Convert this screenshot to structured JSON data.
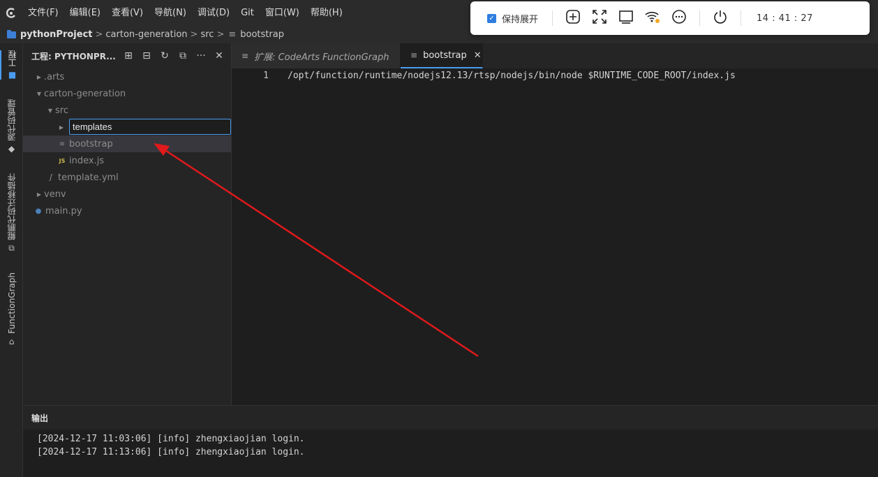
{
  "menubar": {
    "items": [
      {
        "label": "文件(F)"
      },
      {
        "label": "编辑(E)"
      },
      {
        "label": "查看(V)"
      },
      {
        "label": "导航(N)"
      },
      {
        "label": "调试(D)"
      },
      {
        "label": "Git"
      },
      {
        "label": "窗口(W)"
      },
      {
        "label": "帮助(H)"
      }
    ]
  },
  "breadcrumb": {
    "root": "pythonProject",
    "parts": [
      "carton-generation",
      "src",
      "bootstrap"
    ]
  },
  "activitybar": {
    "items": [
      {
        "label": "工程"
      },
      {
        "label": "源代码管理"
      },
      {
        "label": "鲲鹏代码迁移插件"
      },
      {
        "label": "FunctionGraph"
      }
    ]
  },
  "sidebar": {
    "title": "工程: PYTHONPR...",
    "tree": [
      {
        "label": ".arts",
        "icon": "caret-right"
      },
      {
        "label": "carton-generation",
        "icon": "caret-down"
      },
      {
        "label": "src",
        "icon": "caret-down"
      },
      {
        "label": "",
        "icon": "caret-right"
      },
      {
        "label": "bootstrap",
        "icon": "text-file-icon"
      },
      {
        "label": "index.js",
        "icon": "js-file-icon",
        "badge": "JS"
      },
      {
        "label": "template.yml",
        "icon": "yml-file-icon"
      },
      {
        "label": "venv",
        "icon": "caret-right"
      },
      {
        "label": "main.py",
        "icon": "python-file-icon"
      }
    ],
    "rename_value": "templates"
  },
  "tabs": [
    {
      "label": "扩展: CodeArts FunctionGraph"
    },
    {
      "label": "bootstrap"
    }
  ],
  "editor": {
    "line_number": "1",
    "code": "/opt/function/runtime/nodejs12.13/rtsp/nodejs/bin/node $RUNTIME_CODE_ROOT/index.js"
  },
  "output": {
    "title": "输出",
    "lines": [
      "[2024-12-17 11:03:06] [info] zhengxiaojian login.",
      "[2024-12-17 11:13:06] [info] zhengxiaojian login."
    ]
  },
  "float_toolbar": {
    "keep_expanded_label": "保持展开",
    "time": "14 : 41 : 27"
  },
  "colors": {
    "accent": "#4a9cf0",
    "annotation_arrow": "#e0191b"
  }
}
